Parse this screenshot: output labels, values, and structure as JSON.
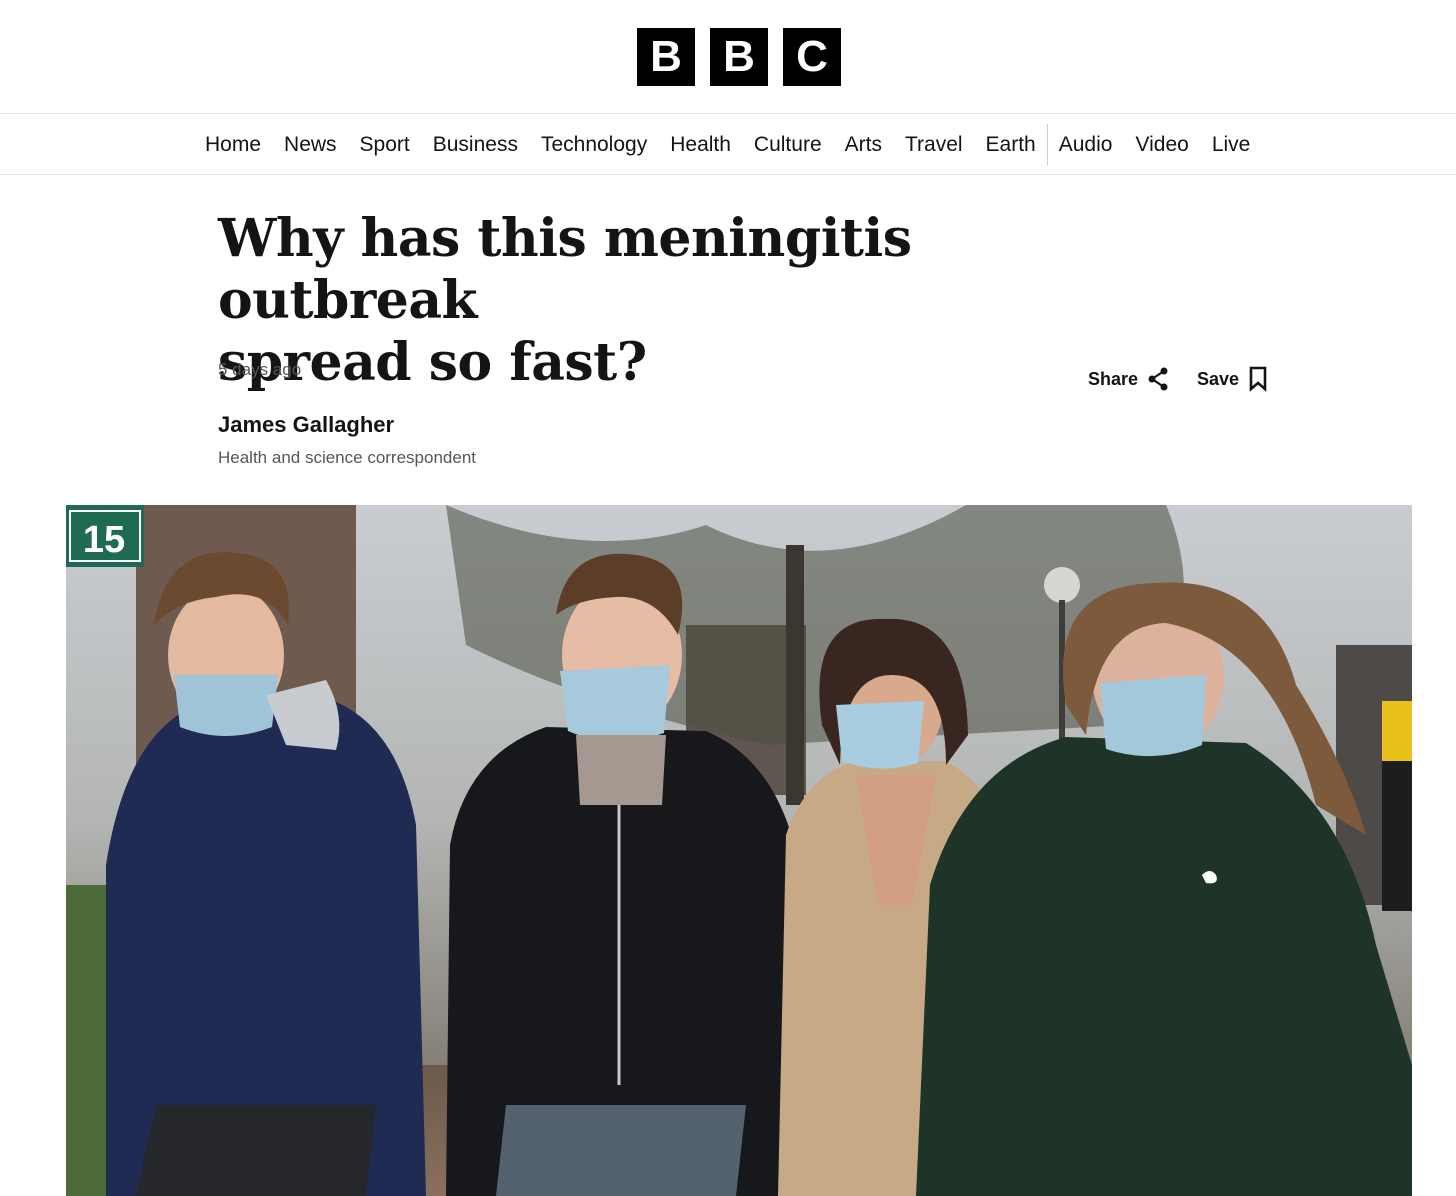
{
  "masthead": {
    "logo_letters": [
      "B",
      "B",
      "C"
    ]
  },
  "nav": {
    "items": [
      {
        "label": "Home"
      },
      {
        "label": "News"
      },
      {
        "label": "Sport"
      },
      {
        "label": "Business"
      },
      {
        "label": "Technology"
      },
      {
        "label": "Health"
      },
      {
        "label": "Culture"
      },
      {
        "label": "Arts"
      },
      {
        "label": "Travel"
      },
      {
        "label": "Earth"
      },
      {
        "label": "Audio"
      },
      {
        "label": "Video"
      },
      {
        "label": "Live"
      }
    ]
  },
  "article": {
    "headline_line1": "Why has this meningitis outbreak",
    "headline_line2": "spread so fast?",
    "timestamp": "5 days ago",
    "share_label": "Share",
    "save_label": "Save",
    "author_name": "James Gallagher",
    "author_role": "Health and science correspondent"
  },
  "hero_image": {
    "sign_number": "15"
  }
}
